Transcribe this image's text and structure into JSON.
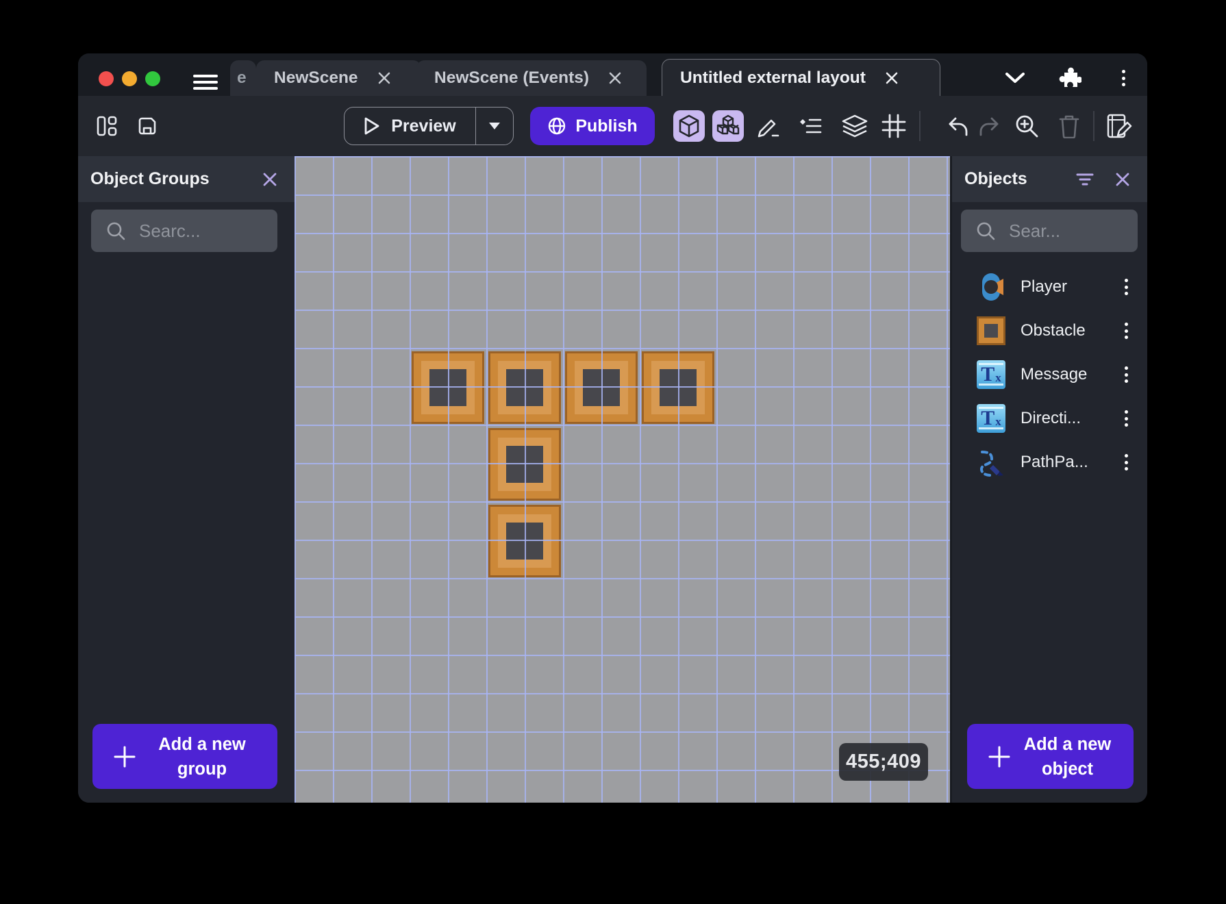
{
  "tabs": {
    "fragment_label": "e",
    "items": [
      {
        "label": "NewScene",
        "active": false
      },
      {
        "label": "NewScene (Events)",
        "active": false
      },
      {
        "label": "Untitled external layout",
        "active": true
      }
    ]
  },
  "toolbar": {
    "preview_label": "Preview",
    "publish_label": "Publish"
  },
  "left_panel": {
    "title": "Object Groups",
    "search_placeholder": "Searc...",
    "add_button_line1": "Add a new",
    "add_button_line2": "group"
  },
  "right_panel": {
    "title": "Objects",
    "search_placeholder": "Sear...",
    "add_button_line1": "Add a new",
    "add_button_line2": "object",
    "objects": [
      {
        "label": "Player",
        "icon": "player-sprite"
      },
      {
        "label": "Obstacle",
        "icon": "obstacle-tile"
      },
      {
        "label": "Message",
        "icon": "text-object"
      },
      {
        "label": "Directi...",
        "icon": "text-object"
      },
      {
        "label": "PathPa...",
        "icon": "path-paint"
      }
    ]
  },
  "canvas": {
    "coordinates": "455;409",
    "grid_cell": 56,
    "tile_size": 106,
    "tiles": [
      {
        "col": 3,
        "row": 5
      },
      {
        "col": 5,
        "row": 5
      },
      {
        "col": 7,
        "row": 5
      },
      {
        "col": 9,
        "row": 5
      },
      {
        "col": 5,
        "row": 7
      },
      {
        "col": 5,
        "row": 9
      }
    ]
  },
  "colors": {
    "accent_purple": "#4e23d4",
    "mode_button_lavender": "#c9b9f0",
    "canvas_gray": "#9d9ea1",
    "grid_line_blue": "#a8b4f5",
    "tile_orange": "#cc8838",
    "tile_border": "#9b6226",
    "tile_core_gray": "#47474c",
    "panel_header": "#2e323b",
    "panel_body": "#22252d"
  }
}
